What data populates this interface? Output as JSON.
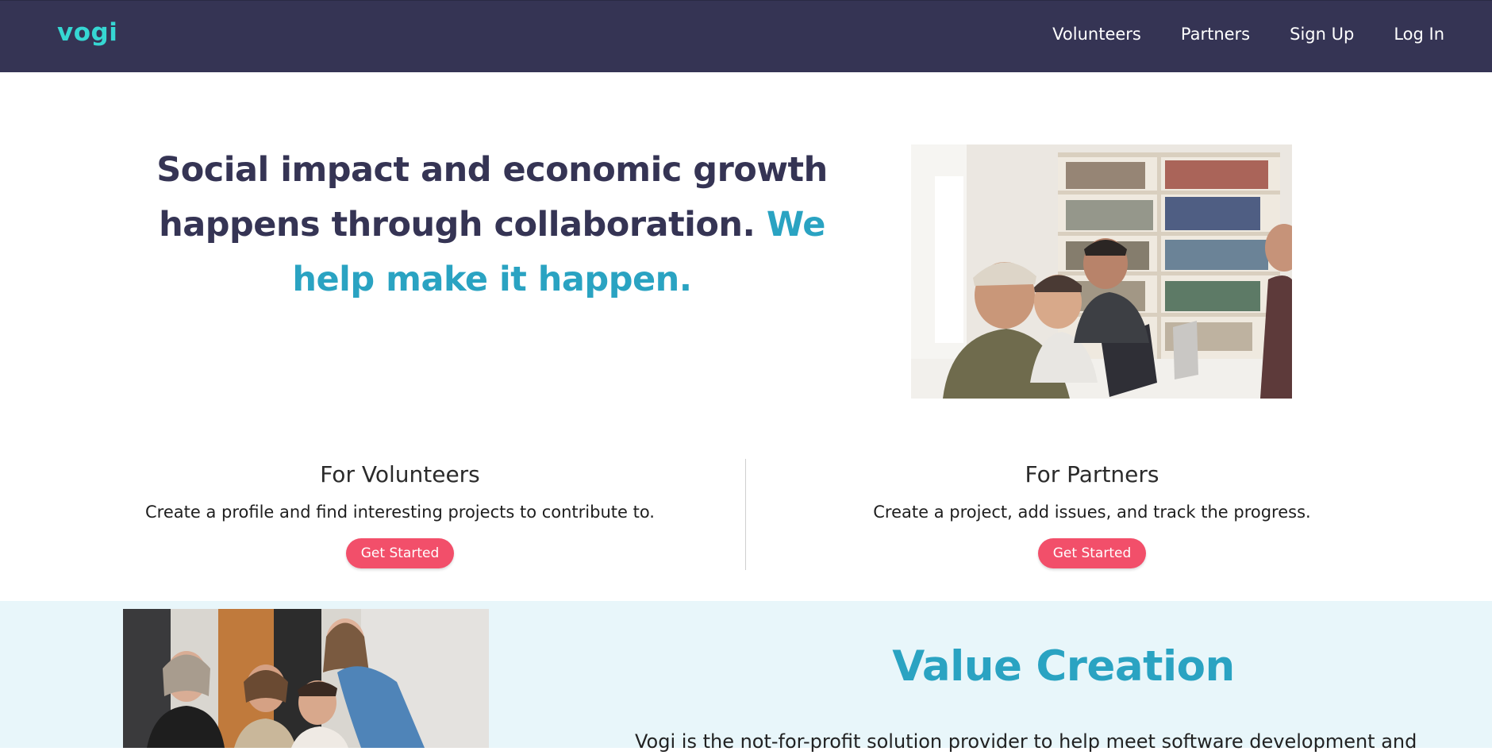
{
  "nav": {
    "logo": "vogi",
    "links": [
      "Volunteers",
      "Partners",
      "Sign Up",
      "Log In"
    ]
  },
  "hero": {
    "title_main": "Social impact and economic growth happens through collaboration.",
    "title_accent": "We help make it happen."
  },
  "volunteers": {
    "heading": "For Volunteers",
    "text": "Create a profile and find interesting projects to contribute to.",
    "button": "Get Started"
  },
  "partners": {
    "heading": "For Partners",
    "text": "Create a project, add issues, and track the progress.",
    "button": "Get Started"
  },
  "value": {
    "title": "Value Creation",
    "text": "Vogi is the not-for-profit solution provider to help meet software development and"
  },
  "colors": {
    "navbar": "#353454",
    "logo": "#36d7d3",
    "accent": "#2aa3c2",
    "button": "#f24f6a",
    "value_bg": "#e8f6fa"
  }
}
